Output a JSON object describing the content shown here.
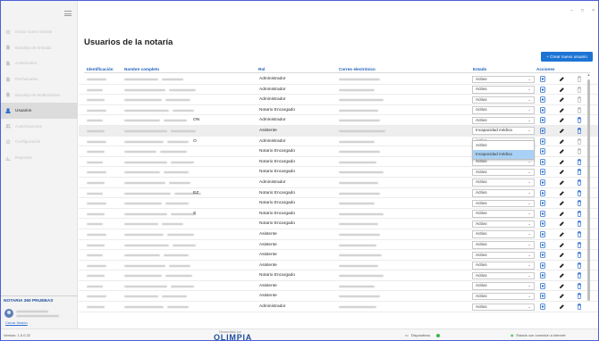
{
  "window": {
    "controls": [
      "−",
      "□",
      "×"
    ]
  },
  "sidebar": {
    "items": [
      {
        "label": "Iniciar nuevo trámite",
        "icon": "gear-icon",
        "active": false
      },
      {
        "label": "Bandeja de entrada",
        "icon": "document-icon",
        "active": false
      },
      {
        "label": "Autorizados",
        "icon": "document-icon",
        "active": false
      },
      {
        "label": "Rechazados",
        "icon": "document-icon",
        "active": false
      },
      {
        "label": "Bandeja de Multitrámites",
        "icon": "document-icon",
        "active": false
      },
      {
        "label": "Usuarios",
        "icon": "user-icon",
        "active": true
      },
      {
        "label": "Autorizaciones",
        "icon": "users-icon",
        "active": false
      },
      {
        "label": "Configuración",
        "icon": "gear-icon",
        "active": false
      },
      {
        "label": "Reportes",
        "icon": "chart-icon",
        "active": false
      }
    ],
    "notary_name": "NOTARIA 360 PRUEBAS",
    "logout_label": "Cerrar Sesión"
  },
  "page": {
    "title": "Usuarios de la notaría",
    "new_user_label": "+ Crear nuevo usuario"
  },
  "table": {
    "columns": {
      "id": "Identificación",
      "name": "Nombre completo",
      "role": "Rol",
      "email": "Correo electrónico",
      "status": "Estado",
      "actions": "Acciones"
    },
    "rows": [
      {
        "name_tail": "",
        "role": "Administrador",
        "status": "Activo"
      },
      {
        "name_tail": "",
        "role": "Administrador",
        "status": "Activo"
      },
      {
        "name_tail": "",
        "role": "Administrador",
        "status": "Activo"
      },
      {
        "name_tail": "",
        "role": "Notario Encargado",
        "status": "Activo"
      },
      {
        "name_tail": "ON",
        "role": "Administrador",
        "status": "Activo"
      },
      {
        "name_tail": "",
        "role": "Asistente",
        "status": "Incapacidad médica"
      },
      {
        "name_tail": "O",
        "role": "Administrador",
        "status": "Activo"
      },
      {
        "name_tail": "",
        "role": "Notario Encargado",
        "status": "Activo"
      },
      {
        "name_tail": "",
        "role": "Notario Encargado",
        "status": "Activo"
      },
      {
        "name_tail": "",
        "role": "Notario Encargado",
        "status": "Activo"
      },
      {
        "name_tail": "",
        "role": "Administrador",
        "status": "Activo"
      },
      {
        "name_tail": "EZ",
        "role": "Notario Encargado",
        "status": "Activo"
      },
      {
        "name_tail": "",
        "role": "Notario Encargado",
        "status": "Activo"
      },
      {
        "name_tail": "S",
        "role": "Notario Encargado",
        "status": "Activo"
      },
      {
        "name_tail": "",
        "role": "Notario Encargado",
        "status": "Activo"
      },
      {
        "name_tail": "",
        "role": "Asistente",
        "status": "Activo"
      },
      {
        "name_tail": "",
        "role": "Asistente",
        "status": "Activo"
      },
      {
        "name_tail": "",
        "role": "Asistente",
        "status": "Activo"
      },
      {
        "name_tail": "",
        "role": "Asistente",
        "status": "Activo"
      },
      {
        "name_tail": "",
        "role": "Notario Encargado",
        "status": "Activo"
      },
      {
        "name_tail": "",
        "role": "Asistente",
        "status": "Activo"
      },
      {
        "name_tail": "",
        "role": "Asistente",
        "status": "Activo"
      },
      {
        "name_tail": "",
        "role": "Administrador",
        "status": "Activo"
      }
    ],
    "dropdown_options": [
      "Activo",
      "Incapacidad médica"
    ]
  },
  "footer": {
    "version": "Version: 1.0.0.22",
    "powered_by": "Desarrollado por",
    "brand": "OLIMPIA",
    "devices_label": "Dispositivos",
    "connection_label": "Estado con conexión a internet"
  },
  "colors": {
    "accent": "#1d74d4",
    "header_text": "#1f5fb8",
    "status_ok": "#3ab54a"
  }
}
